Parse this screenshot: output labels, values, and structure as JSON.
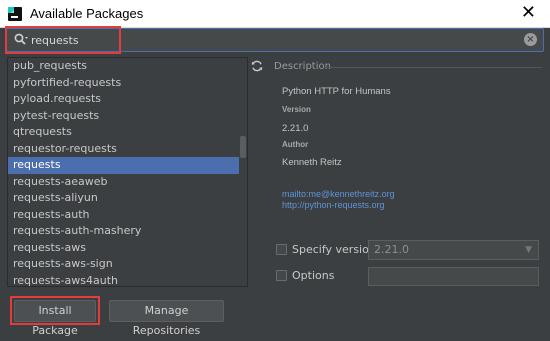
{
  "window": {
    "title": "Available Packages"
  },
  "search": {
    "value": "requests",
    "placeholder": ""
  },
  "packages": [
    "pub_requests",
    "pyfortified-requests",
    "pyload.requests",
    "pytest-requests",
    "qtrequests",
    "requestor-requests",
    "requests",
    "requests-aeaweb",
    "requests-aliyun",
    "requests-auth",
    "requests-auth-mashery",
    "requests-aws",
    "requests-aws-sign",
    "requests-aws4auth"
  ],
  "selected_package": "requests",
  "description": {
    "header": "Description",
    "summary": "Python HTTP for Humans",
    "version_label": "Version",
    "version": "2.21.0",
    "author_label": "Author",
    "author": "Kenneth Reitz",
    "links": [
      "mailto:me@kennethreitz.org",
      "http://python-requests.org"
    ]
  },
  "options": {
    "specify_version_label": "Specify version",
    "version_value": "2.21.0",
    "options_label": "Options",
    "options_value": ""
  },
  "buttons": {
    "install": "Install Package",
    "manage": "Manage Repositories"
  },
  "colors": {
    "background": "#3c3f41",
    "selection": "#4b6eaf",
    "highlight_box": "#e23d3d",
    "link": "#5d94d9"
  }
}
